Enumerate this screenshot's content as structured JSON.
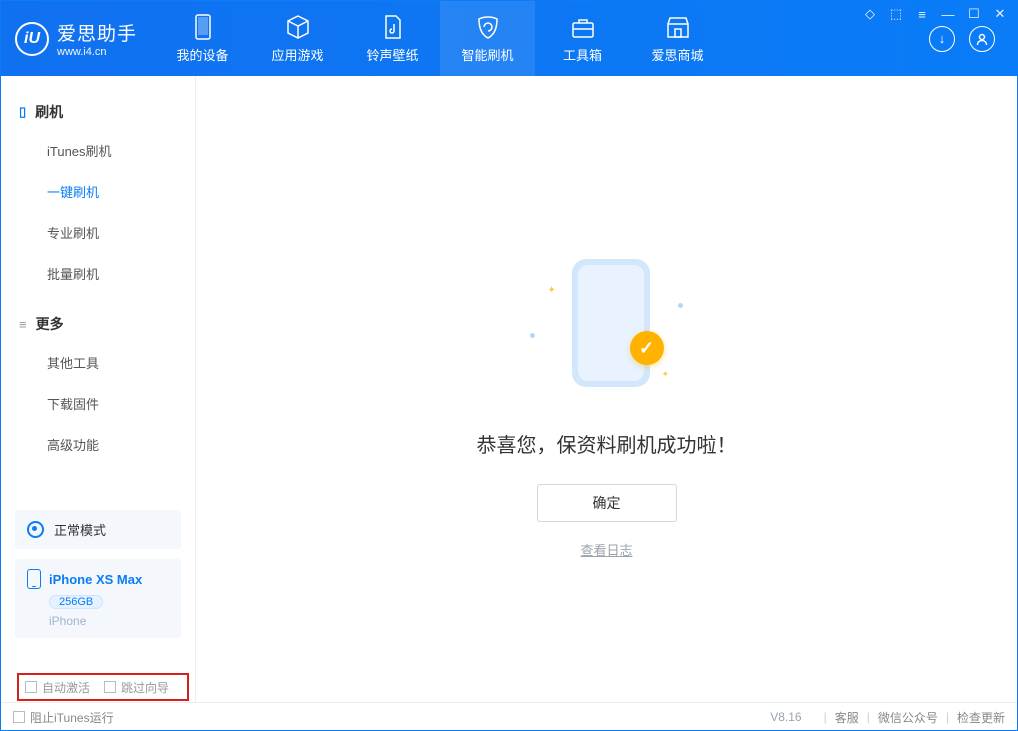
{
  "header": {
    "brand": "爱思助手",
    "domain": "www.i4.cn",
    "logo_letter": "iU",
    "tabs": [
      {
        "label": "我的设备"
      },
      {
        "label": "应用游戏"
      },
      {
        "label": "铃声壁纸"
      },
      {
        "label": "智能刷机"
      },
      {
        "label": "工具箱"
      },
      {
        "label": "爱思商城"
      }
    ]
  },
  "sidebar": {
    "section1": {
      "title": "刷机",
      "items": [
        "iTunes刷机",
        "一键刷机",
        "专业刷机",
        "批量刷机"
      ]
    },
    "section2": {
      "title": "更多",
      "items": [
        "其他工具",
        "下载固件",
        "高级功能"
      ]
    },
    "mode": "正常模式",
    "device": {
      "name": "iPhone XS Max",
      "capacity": "256GB",
      "type": "iPhone"
    }
  },
  "main": {
    "checkmark": "✓",
    "success_message": "恭喜您，保资料刷机成功啦！",
    "ok_button": "确定",
    "view_log": "查看日志"
  },
  "checkboxes": {
    "auto_activate": "自动激活",
    "skip_guide": "跳过向导"
  },
  "footer": {
    "block_itunes": "阻止iTunes运行",
    "version": "V8.16",
    "links": [
      "客服",
      "微信公众号",
      "检查更新"
    ]
  }
}
